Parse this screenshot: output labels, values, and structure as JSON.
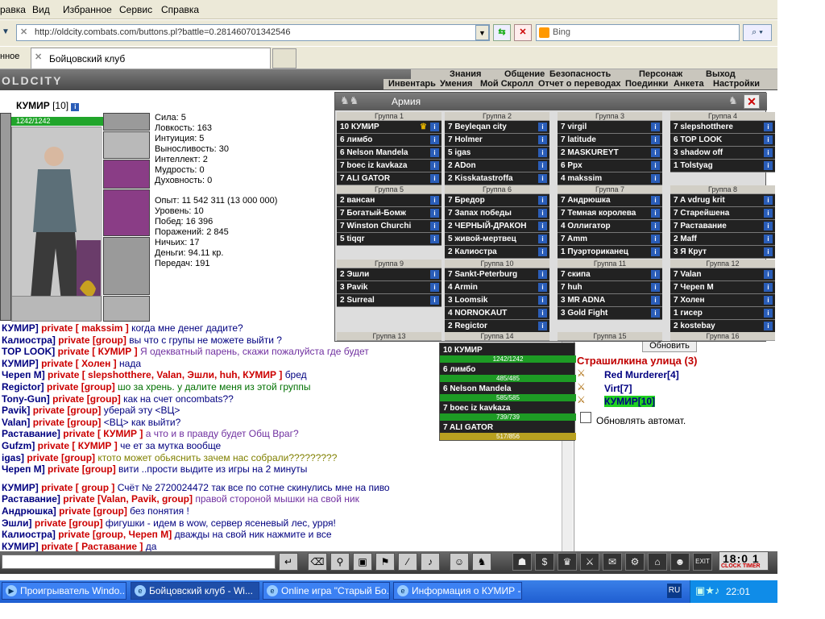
{
  "menu": [
    "равка",
    "Вид",
    "Избранное",
    "Сервис",
    "Справка"
  ],
  "address": {
    "url": "http://oldcity.combats.com/buttons.pl?battle=0.281460701342546"
  },
  "search": {
    "placeholder": "Bing"
  },
  "tabs": {
    "fav": "нное",
    "main": "Бойцовский клуб"
  },
  "logo": "OLDCITY",
  "nav_top": [
    "Знания",
    "Общение",
    "Безопасность",
    "Персонаж",
    "Выход"
  ],
  "nav_bottom": [
    "Инвентарь",
    "Умения",
    "Мой Скролл",
    "Отчет о переводах",
    "Поединки",
    "Анкета",
    "Настройки"
  ],
  "player": {
    "name": "КУМИР",
    "level": "[10]",
    "hp": "1242/1242"
  },
  "stats1": [
    "Сила: 5",
    "Ловкость: 163",
    "Интуиция: 5",
    "Выносливость: 30",
    "Интеллект: 2",
    "Мудрость: 0",
    "Духовность: 0"
  ],
  "stats2": [
    "Опыт: 11 542 311 (13 000 000)",
    "Уровень: 10",
    "Побед: 16 396",
    "Поражений: 2 845",
    "Ничьих: 17",
    "Деньги: 94.11 кр.",
    "Передач: 191"
  ],
  "army": {
    "title": "Армия",
    "groups": [
      {
        "h": "Группа 1",
        "rows": [
          "10  КУМИР",
          "6  лимбо",
          "6  Nelson Mandela",
          "7  boec iz kavkaza",
          "7  ALI GATOR"
        ]
      },
      {
        "h": "Группа 2",
        "rows": [
          "7  Beyleqan city",
          "7  Holmer",
          "5  igas",
          "2  ADon",
          "2  Kisskatastroffa"
        ]
      },
      {
        "h": "Группа 3",
        "rows": [
          "7  virgil",
          "7  latitude",
          "2  MASKUREYT",
          "6  Ppx",
          "4  makssim"
        ]
      },
      {
        "h": "Группа 4",
        "rows": [
          "7  slepshotthere",
          "6  TOP LOOK",
          "3  shadow off",
          "1  Tolstyag"
        ]
      },
      {
        "h": "Группа 5",
        "rows": [
          "2  вансан",
          "7  Богатый-Бомж",
          "7  Winston Churchi",
          "5  tiqqr"
        ]
      },
      {
        "h": "Группа 6",
        "rows": [
          "7  Бредор",
          "7  Запах победы",
          "2  ЧЕРНЫЙ-ДРАКОН",
          "5  живой-мертвец",
          "2  Калиостра"
        ]
      },
      {
        "h": "Группа 7",
        "rows": [
          "7  Андрюшка",
          "7  Темная королева",
          "4  Оллигатор",
          "7  Amm",
          "1  Пуэрториканец"
        ]
      },
      {
        "h": "Группа 8",
        "rows": [
          "7  A vdrug krit",
          "7  Старейшена",
          "7  Раставание",
          "2  Maff",
          "3  Я Крут"
        ]
      },
      {
        "h": "Группа 9",
        "rows": [
          "2  Эшли",
          "3  Pavik",
          "2  Surreal"
        ]
      },
      {
        "h": "Группа 10",
        "rows": [
          "7  Sankt-Peterburg",
          "4  Armin",
          "3  Loomsik",
          "4  NORNOKAUT",
          "2  Regictor"
        ]
      },
      {
        "h": "Группа 11",
        "rows": [
          "7  скипа",
          "7  huh",
          "3  MR ADNA",
          "3  Gold Fight"
        ]
      },
      {
        "h": "Группа 12",
        "rows": [
          "7  Valan",
          "7  Черeп M",
          "7  Холен",
          "1  гисер",
          "2  kostebay"
        ]
      }
    ],
    "groups_more": [
      "Группа 13",
      "Группа 14",
      "Группа 15",
      "Группа 16"
    ]
  },
  "popup": [
    {
      "t": "10  КУМИР",
      "hp": "1242/1242"
    },
    {
      "t": "6  лимбо",
      "hp": "485/485"
    },
    {
      "t": "6  Nelson Mandela",
      "hp": "585/585"
    },
    {
      "t": "7  boec iz kavkaza",
      "hp": "739/739"
    },
    {
      "t": "7  ALI GATOR",
      "hp": "517/856"
    }
  ],
  "chat": [
    {
      "n": "КУМИР]",
      "p": "private [ makssim ]",
      "m": "когда мне денег дадите?",
      "c": "msg"
    },
    {
      "n": "Калиостра]",
      "p": "private [group]",
      "m": "вы что с групы не можете выйти ?",
      "c": "msg"
    },
    {
      "n": "TOP LOOK]",
      "p": "private [ КУМИР ]",
      "m": "Я одекватный парень, скажи пожалуйста где будет",
      "c": "msg2"
    },
    {
      "n": "КУМИР]",
      "p": "private [ Холен ]",
      "m": "нада",
      "c": "msg"
    },
    {
      "n": "Череп M]",
      "p": "private [ slepshotthere, Valan, Эшли, huh, КУМИР ]",
      "m": "бред",
      "c": "msg"
    },
    {
      "n": "Regictor]",
      "p": "private [group]",
      "m": "шо за хрень. у далите меня из этой группы",
      "c": "msg3"
    },
    {
      "n": "Tony-Gun]",
      "p": "private [group]",
      "m": "как на счет oncombats??",
      "c": "msg"
    },
    {
      "n": "Pavik]",
      "p": "private [group]",
      "m": "уберай эту <ВЦ>",
      "c": "msg"
    },
    {
      "n": "Valan]",
      "p": "private [group]",
      "m": "<ВЦ> как выйти?",
      "c": "msg"
    },
    {
      "n": "Раставание]",
      "p": "private [ КУМИР ]",
      "m": "а что и в правду будет Общ Враг?",
      "c": "msg2"
    },
    {
      "n": "Gufzm]",
      "p": "private [ КУМИР ]",
      "m": "че ет за мутка вообще",
      "c": "msg"
    },
    {
      "n": "igas]",
      "p": "private [group]",
      "m": "ктото может обьяснить зачем нас собрали?????????",
      "c": "msg4"
    },
    {
      "n": "Череп M]",
      "p": "private [group]",
      "m": "вити ..прости выдите из игры на 2 минуты",
      "c": "msg"
    },
    {
      "n": "КУМИР]",
      "p": "private [ group ]",
      "m": "Счёт № 2720024472       так все по сотне скинулись мне на пиво",
      "c": "msg"
    },
    {
      "n": "Раставание]",
      "p": "private [Valan, Pavik, group]",
      "m": "правой стороной мышки на свой ник",
      "c": "msg2"
    },
    {
      "n": "Андрюшка]",
      "p": "private [group]",
      "m": "без понятия !",
      "c": "msg"
    },
    {
      "n": "Эшли]",
      "p": "private [group]",
      "m": "фигушки - идем в wow, сервер ясеневый лес, урря!",
      "c": "msg"
    },
    {
      "n": "Калиостра]",
      "p": "private [group, Череп M]",
      "m": "дважды на свой ник нажмите и все",
      "c": "msg"
    },
    {
      "n": "КУМИР]",
      "p": "private [ Раставание ]",
      "m": "да",
      "c": "msg"
    }
  ],
  "right": {
    "refresh": "Обновить",
    "location": "Страшилкина улица (3)",
    "people": [
      "Red Murderer[4]",
      "Virt[7]",
      "КУМИР[10]"
    ],
    "auto": "Обновлять автомат."
  },
  "clock": {
    "time": "18:0 1",
    "label": "CLOCK TIMER"
  },
  "taskbar": [
    "Проигрыватель Windo...",
    "Бойцовский клуб - Wi...",
    "Online игра \"Старый Бо...",
    "Информация о КУМИР - ..."
  ],
  "tray": {
    "lang": "RU",
    "time": "22:01"
  }
}
